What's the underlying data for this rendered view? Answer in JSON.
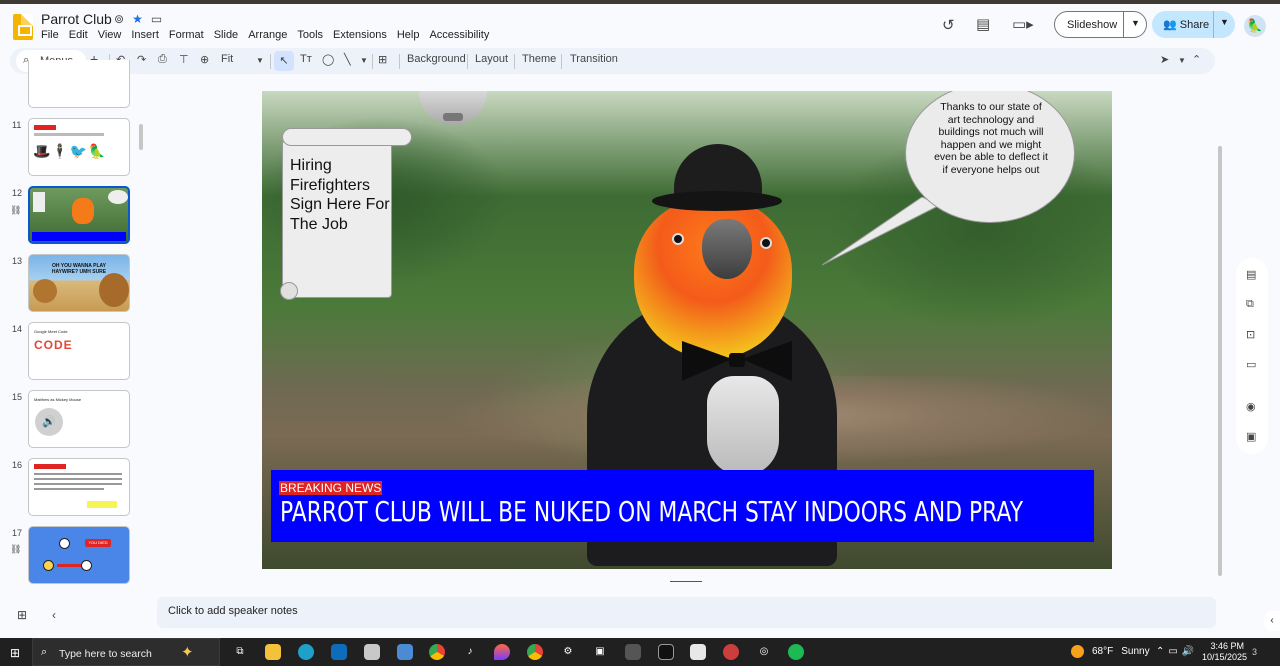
{
  "doc": {
    "title": "Parrot Club",
    "menu": [
      "File",
      "Edit",
      "View",
      "Insert",
      "Format",
      "Slide",
      "Arrange",
      "Tools",
      "Extensions",
      "Help",
      "Accessibility"
    ]
  },
  "header": {
    "slideshow_label": "Slideshow",
    "share_label": "Share"
  },
  "toolbar": {
    "menus_label": "Menus",
    "zoom_label": "Fit",
    "background_label": "Background",
    "layout_label": "Layout",
    "theme_label": "Theme",
    "transition_label": "Transition"
  },
  "filmstrip": {
    "slides": [
      {
        "number": "11",
        "selected": false,
        "linked": false
      },
      {
        "number": "12",
        "selected": true,
        "linked": true
      },
      {
        "number": "13",
        "selected": false,
        "linked": false,
        "caption": "OH YOU WANNA PLAY HAYWIRE? UMH SURE"
      },
      {
        "number": "14",
        "selected": false,
        "linked": false,
        "caption": "Google Meet Code",
        "code_text": "CODE"
      },
      {
        "number": "15",
        "selected": false,
        "linked": false,
        "caption": "Matthew as Mickey Mouse"
      },
      {
        "number": "16",
        "selected": false,
        "linked": false
      },
      {
        "number": "17",
        "selected": false,
        "linked": true,
        "badge": "YOU DIED"
      }
    ]
  },
  "slide": {
    "scroll_text": "Hiring Firefighters Sign Here For The Job",
    "bubble_text": "Thanks to our state of art technology and buildings not much will happen and we might even be able to deflect it if everyone helps out",
    "news_tag": "BREAKING NEWS",
    "news_headline": "PARROT CLUB WILL BE NUKED ON MARCH STAY INDOORS AND PRAY"
  },
  "notes": {
    "placeholder": "Click to add speaker notes"
  },
  "taskbar": {
    "search_placeholder": "Type here to search",
    "weather_temp": "68°F",
    "weather_desc": "Sunny",
    "time": "3:46 PM",
    "date": "10/15/2025",
    "notification_count": "3"
  },
  "colors": {
    "accent": "#0b57d0",
    "news_blue": "#0000ff",
    "news_red": "#e02424",
    "share_bg": "#c2e7ff"
  }
}
